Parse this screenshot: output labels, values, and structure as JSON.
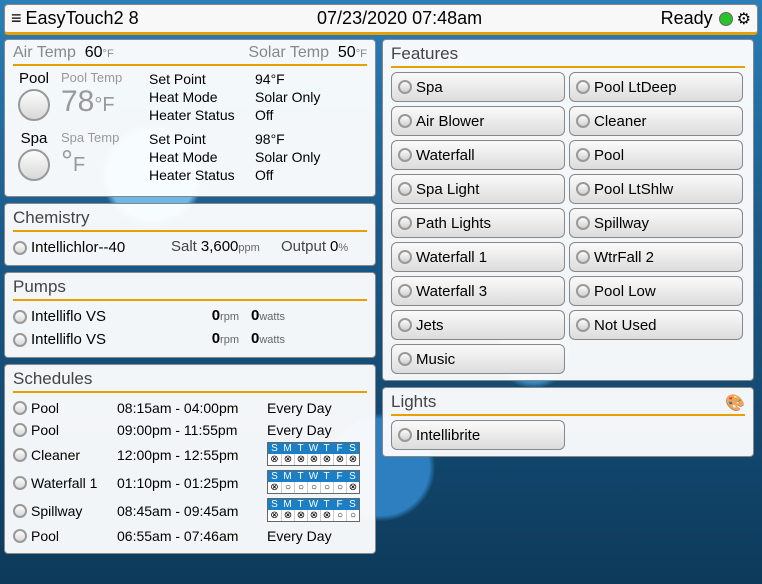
{
  "header": {
    "title": "EasyTouch2 8",
    "datetime": "07/23/2020 07:48am",
    "status": "Ready"
  },
  "temps": {
    "air_label": "Air Temp",
    "air_value": "60",
    "air_unit": "°F",
    "solar_label": "Solar Temp",
    "solar_value": "50",
    "solar_unit": "°F"
  },
  "bodies": [
    {
      "name": "Pool",
      "temp_label": "Pool Temp",
      "temp_value": "78",
      "temp_unit": "°F",
      "setpoint": "94°F",
      "heatmode": "Solar Only",
      "heaterstatus": "Off"
    },
    {
      "name": "Spa",
      "temp_label": "Spa Temp",
      "temp_value": "°",
      "temp_unit": "F",
      "setpoint": "98°F",
      "heatmode": "Solar Only",
      "heaterstatus": "Off"
    }
  ],
  "labels": {
    "setpoint": "Set Point",
    "heatmode": "Heat Mode",
    "heaterstatus": "Heater Status",
    "chemistry": "Chemistry",
    "salt": "Salt",
    "output": "Output",
    "pumps": "Pumps",
    "rpm": "rpm",
    "watts": "watts",
    "ppm": "ppm",
    "pct": "%",
    "schedules": "Schedules",
    "features": "Features",
    "lights": "Lights"
  },
  "chem": {
    "name": "Intellichlor--40",
    "salt": "3,600",
    "output": "0"
  },
  "pumps": [
    {
      "name": "Intelliflo VS",
      "rpm": "0",
      "watts": "0"
    },
    {
      "name": "Intelliflo VS",
      "rpm": "0",
      "watts": "0"
    }
  ],
  "schedules": [
    {
      "name": "Pool",
      "times": "08:15am - 04:00pm",
      "days_text": "Every Day",
      "days": null
    },
    {
      "name": "Pool",
      "times": "09:00pm - 11:55pm",
      "days_text": "Every Day",
      "days": null
    },
    {
      "name": "Cleaner",
      "times": "12:00pm - 12:55pm",
      "days_text": null,
      "days": [
        true,
        true,
        true,
        true,
        true,
        true,
        true
      ]
    },
    {
      "name": "Waterfall 1",
      "times": "01:10pm - 01:25pm",
      "days_text": null,
      "days": [
        true,
        false,
        false,
        false,
        false,
        false,
        true
      ]
    },
    {
      "name": "Spillway",
      "times": "08:45am - 09:45am",
      "days_text": null,
      "days": [
        true,
        true,
        true,
        true,
        true,
        false,
        false
      ]
    },
    {
      "name": "Pool",
      "times": "06:55am - 07:46am",
      "days_text": "Every Day",
      "days": null
    }
  ],
  "day_headers": [
    "S",
    "M",
    "T",
    "W",
    "T",
    "F",
    "S"
  ],
  "features": [
    "Spa",
    "Pool LtDeep",
    "Air Blower",
    "Cleaner",
    "Waterfall",
    "Pool",
    "Spa Light",
    "Pool LtShlw",
    "Path Lights",
    "Spillway",
    "Waterfall 1",
    "WtrFall 2",
    "Waterfall 3",
    "Pool Low",
    "Jets",
    "Not Used",
    "Music"
  ],
  "lights": [
    "Intellibrite"
  ]
}
